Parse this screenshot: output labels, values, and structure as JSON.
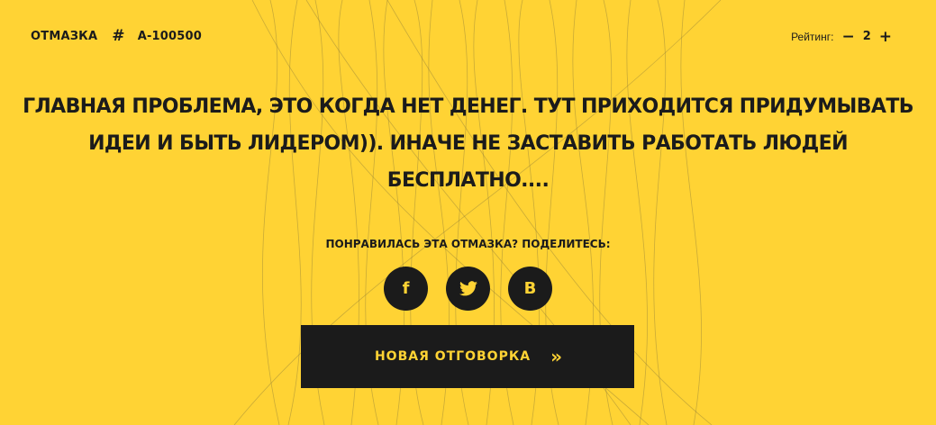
{
  "header": {
    "brand": "ОТМАЗКА",
    "hash_symbol": "#",
    "excuse_id": "А-100500"
  },
  "rating": {
    "label": "Рейтинг:",
    "minus": "−",
    "value": "2",
    "plus": "+"
  },
  "quote": {
    "text": "Главная проблема, это когда нет денег. Тут приходится придумывать идеи и быть лидером)). Иначе не заставить работать людей бесплатно...."
  },
  "share": {
    "label": "ПОНРАВИЛАСЬ ЭТА ОТМАЗКА? ПОДЕЛИТЕСЬ:",
    "facebook": "f",
    "vk": "В"
  },
  "new_button": {
    "label": "НОВАЯ ОТГОВОРКА",
    "chevron": "»"
  },
  "colors": {
    "background": "#FFD334",
    "dark": "#1B1B1B"
  },
  "icons": {
    "facebook": "facebook-icon",
    "twitter": "twitter-icon",
    "vk": "vk-icon",
    "chevron": "double-chevron-right-icon"
  }
}
